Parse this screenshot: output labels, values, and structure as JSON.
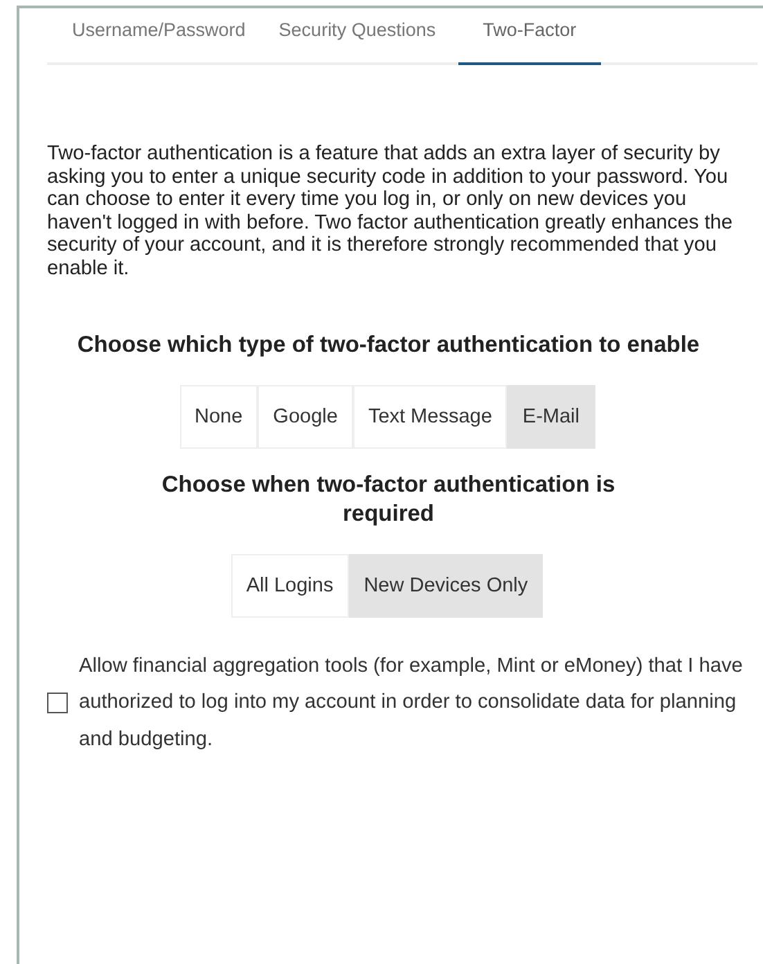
{
  "tabs": [
    {
      "label": "Username/Password",
      "selected": false
    },
    {
      "label": "Security Questions",
      "selected": false
    },
    {
      "label": "Two-Factor",
      "selected": true
    }
  ],
  "intro": "Two-factor authentication is a feature that adds an extra layer of security by asking you to enter a unique security code in addition to your password. You can choose to enter it every time you log in, or only on new devices you haven't logged in with before. Two factor authentication greatly enhances the security of your account, and it is therefore strongly recommended that you enable it.",
  "type_heading": "Choose which type of two-factor authentication to enable",
  "type_options": [
    {
      "label": "None",
      "selected": false
    },
    {
      "label": "Google",
      "selected": false
    },
    {
      "label": "Text Message",
      "selected": false
    },
    {
      "label": "E-Mail",
      "selected": true
    }
  ],
  "when_heading": "Choose when two-factor authentication is required",
  "when_options": [
    {
      "label": "All Logins",
      "selected": false
    },
    {
      "label": "New Devices Only",
      "selected": true
    }
  ],
  "aggregation": {
    "label": "Allow financial aggregation tools (for example, Mint or eMoney) that I have authorized to log into my account in order to consolidate data for planning and budgeting.",
    "checked": false
  }
}
